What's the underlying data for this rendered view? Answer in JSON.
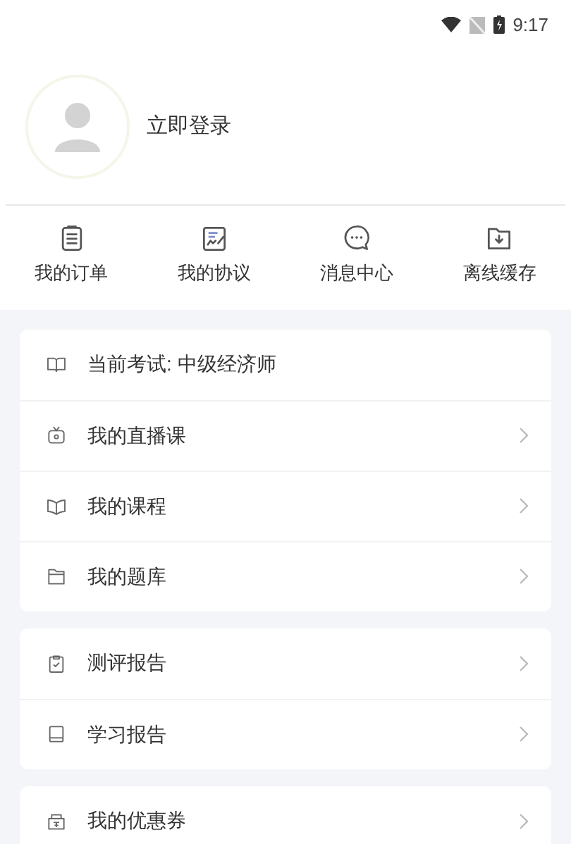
{
  "status_bar": {
    "time": "9:17"
  },
  "profile": {
    "login_label": "立即登录"
  },
  "shortcuts": [
    {
      "label": "我的订单"
    },
    {
      "label": "我的协议"
    },
    {
      "label": "消息中心"
    },
    {
      "label": "离线缓存"
    }
  ],
  "menu_groups": [
    {
      "items": [
        {
          "label": "当前考试: 中级经济师",
          "chevron": false
        },
        {
          "label": "我的直播课",
          "chevron": true
        },
        {
          "label": "我的课程",
          "chevron": true
        },
        {
          "label": "我的题库",
          "chevron": true
        }
      ]
    },
    {
      "items": [
        {
          "label": "测评报告",
          "chevron": true
        },
        {
          "label": "学习报告",
          "chevron": true
        }
      ]
    },
    {
      "items": [
        {
          "label": "我的优惠券",
          "chevron": true
        }
      ]
    }
  ]
}
